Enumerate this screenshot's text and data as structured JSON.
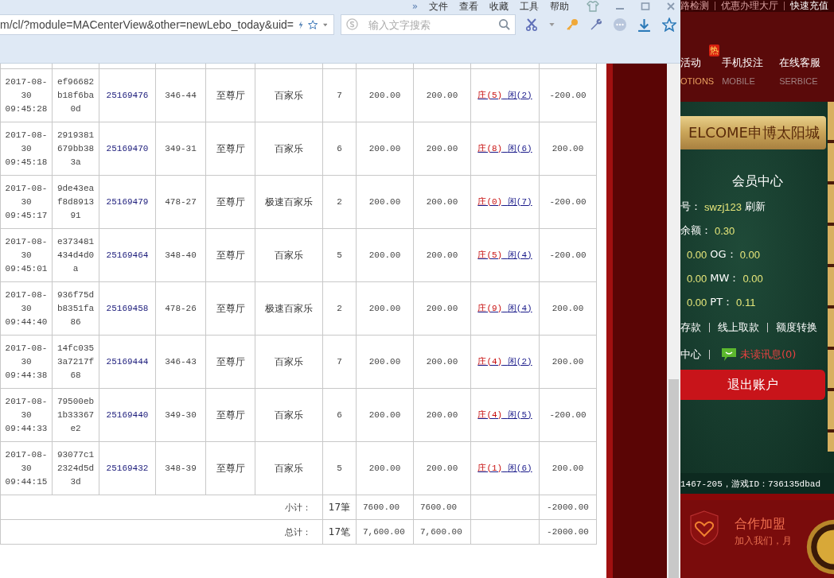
{
  "browser": {
    "menu": [
      "»",
      "文件",
      "查看",
      "收藏",
      "工具",
      "帮助"
    ],
    "address": "m/cl/?module=MACenterView&other=newLebo_today&uid=",
    "search": {
      "placeholder": "输入文字搜索"
    }
  },
  "table": {
    "rows": [
      {
        "date": "2017-08-30",
        "time": "09:45:28",
        "hash": "ef96682b18f6ba0d",
        "bet_id": "25169476",
        "round": "346-44",
        "hall": "至尊厅",
        "game": "百家乐",
        "table": "7",
        "bet": "200.00",
        "valid": "200.00",
        "banker": "庄(5)",
        "player": "闲(2)",
        "result": "-200.00"
      },
      {
        "date": "2017-08-30",
        "time": "09:45:18",
        "hash": "2919381679bb383a",
        "bet_id": "25169470",
        "round": "349-31",
        "hall": "至尊厅",
        "game": "百家乐",
        "table": "6",
        "bet": "200.00",
        "valid": "200.00",
        "banker": "庄(8)",
        "player": "闲(6)",
        "result": "200.00"
      },
      {
        "date": "2017-08-30",
        "time": "09:45:17",
        "hash": "9de43eaf8d891391",
        "bet_id": "25169479",
        "round": "478-27",
        "hall": "至尊厅",
        "game": "极速百家乐",
        "table": "2",
        "bet": "200.00",
        "valid": "200.00",
        "banker": "庄(0)",
        "player": "闲(7)",
        "result": "-200.00"
      },
      {
        "date": "2017-08-30",
        "time": "09:45:01",
        "hash": "e373481434d4d0a",
        "bet_id": "25169464",
        "round": "348-40",
        "hall": "至尊厅",
        "game": "百家乐",
        "table": "5",
        "bet": "200.00",
        "valid": "200.00",
        "banker": "庄(5)",
        "player": "闲(4)",
        "result": "-200.00"
      },
      {
        "date": "2017-08-30",
        "time": "09:44:40",
        "hash": "936f75db8351fa86",
        "bet_id": "25169458",
        "round": "478-26",
        "hall": "至尊厅",
        "game": "极速百家乐",
        "table": "2",
        "bet": "200.00",
        "valid": "200.00",
        "banker": "庄(9)",
        "player": "闲(4)",
        "result": "200.00"
      },
      {
        "date": "2017-08-30",
        "time": "09:44:38",
        "hash": "14fc0353a7217f68",
        "bet_id": "25169444",
        "round": "346-43",
        "hall": "至尊厅",
        "game": "百家乐",
        "table": "7",
        "bet": "200.00",
        "valid": "200.00",
        "banker": "庄(4)",
        "player": "闲(2)",
        "result": "200.00"
      },
      {
        "date": "2017-08-30",
        "time": "09:44:33",
        "hash": "79500eb1b33367e2",
        "bet_id": "25169440",
        "round": "349-30",
        "hall": "至尊厅",
        "game": "百家乐",
        "table": "6",
        "bet": "200.00",
        "valid": "200.00",
        "banker": "庄(4)",
        "player": "闲(5)",
        "result": "-200.00"
      },
      {
        "date": "2017-08-30",
        "time": "09:44:15",
        "hash": "93077c12324d5d3d",
        "bet_id": "25169432",
        "round": "348-39",
        "hall": "至尊厅",
        "game": "百家乐",
        "table": "5",
        "bet": "200.00",
        "valid": "200.00",
        "banker": "庄(1)",
        "player": "闲(6)",
        "result": "200.00"
      }
    ],
    "summary": [
      {
        "label": "小计：",
        "count": "17筆",
        "bet": "7600.00",
        "valid": "7600.00",
        "result": "-2000.00"
      },
      {
        "label": "总计：",
        "count": "17笔",
        "bet": "7,600.00",
        "valid": "7,600.00",
        "result": "-2000.00"
      }
    ]
  },
  "site": {
    "top_links": [
      "路检测",
      "优惠办理大厅",
      "快速充值"
    ],
    "nav": [
      {
        "label": "活动",
        "sub": "OTIONS",
        "hot": "热",
        "selected": true
      },
      {
        "label": "手机投注",
        "sub": "MOBILE",
        "selected": false
      },
      {
        "label": "在线客服",
        "sub": "SERBICE",
        "selected": false
      }
    ],
    "welcome": "ELCOME申博太阳城",
    "member": {
      "title": "会员中心",
      "lines": [
        [
          {
            "kind": "label",
            "text": "号："
          },
          {
            "kind": "value",
            "text": "swzj123"
          },
          {
            "kind": "link",
            "text": "刷新"
          }
        ],
        [
          {
            "kind": "label",
            "text": "余额："
          },
          {
            "kind": "value",
            "text": "0.30"
          }
        ],
        [
          {
            "kind": "value",
            "text": "0.00"
          },
          {
            "kind": "label",
            "text": "OG："
          },
          {
            "kind": "value",
            "text": "0.00"
          }
        ],
        [
          {
            "kind": "value",
            "text": "0.00"
          },
          {
            "kind": "label",
            "text": "MW："
          },
          {
            "kind": "value",
            "text": "0.00"
          }
        ],
        [
          {
            "kind": "value",
            "text": "0.00"
          },
          {
            "kind": "label",
            "text": "PT："
          },
          {
            "kind": "value",
            "text": "0.11"
          }
        ]
      ],
      "actions": [
        "存款",
        "线上取款",
        "额度转换"
      ],
      "message_prefix": "中心",
      "unread": "未读讯息(0)",
      "logout": "退出账户"
    },
    "game_info": "1467-205，游戏ID：736135dbad",
    "join": {
      "title": "合作加盟",
      "subtitle": "加入我们，月"
    }
  }
}
